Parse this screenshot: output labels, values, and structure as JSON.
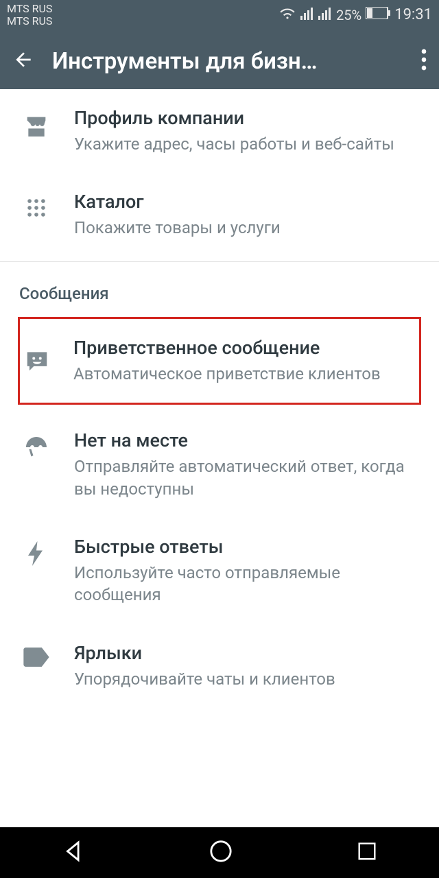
{
  "status": {
    "carrier1": "MTS RUS",
    "carrier2": "MTS RUS",
    "battery_pct": "25%",
    "time": "19:31"
  },
  "appbar": {
    "title": "Инструменты для бизн…"
  },
  "items": {
    "profile": {
      "title": "Профиль компании",
      "sub": "Укажите адрес, часы работы и веб-сайты"
    },
    "catalog": {
      "title": "Каталог",
      "sub": "Покажите товары и услуги"
    }
  },
  "section": {
    "messages": "Сообщения"
  },
  "msgitems": {
    "greeting": {
      "title": "Приветственное сообщение",
      "sub": "Автоматическое приветствие клиентов"
    },
    "away": {
      "title": "Нет на месте",
      "sub": "Отправляйте автоматический ответ, когда вы недоступны"
    },
    "quick": {
      "title": "Быстрые ответы",
      "sub": "Используйте часто отправляемые сообщения"
    },
    "labels": {
      "title": "Ярлыки",
      "sub": "Упорядочивайте чаты и клиентов"
    }
  }
}
